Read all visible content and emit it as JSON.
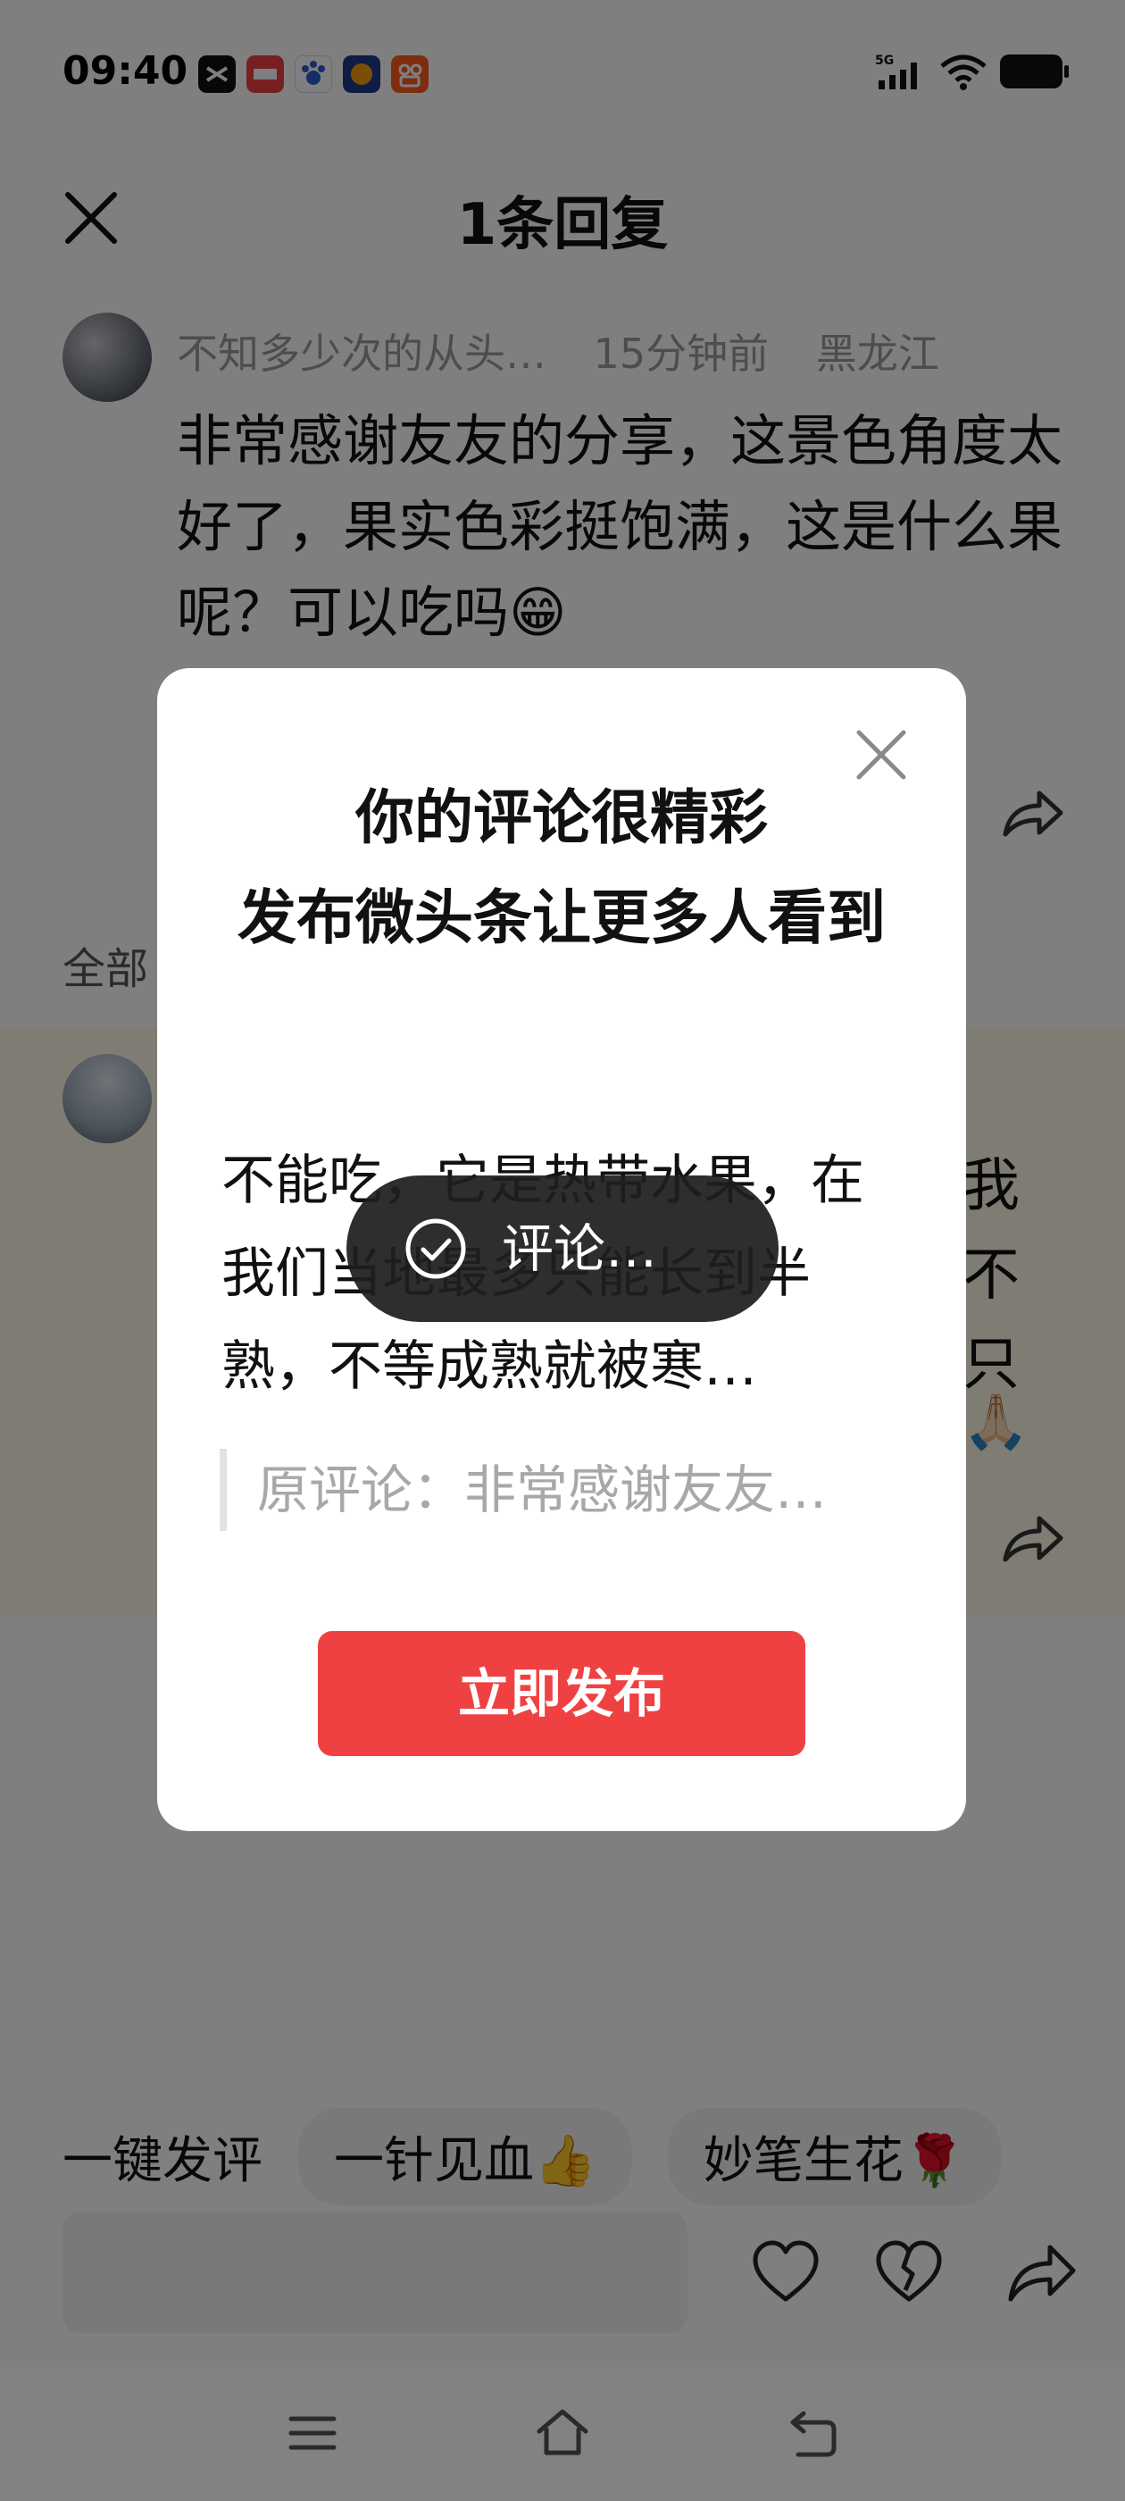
{
  "status_bar": {
    "time": "09:40",
    "network": "5G",
    "app_icons": [
      "capcut-icon",
      "toutiao-news-icon",
      "baidu-icon",
      "game-icon",
      "kuaishou-icon"
    ]
  },
  "sheet": {
    "title": "1条回复",
    "original_comment": {
      "username": "不知多少次的从头…",
      "time_ago": "15分钟前",
      "location": "黑龙江",
      "text": "非常感谢友友的分享，这景色角度太好了，果实色彩挺饱满，这是什么果呢？可以吃吗😁"
    },
    "section_label": "全部",
    "reply_partial_chars": [
      "我",
      "不",
      "只",
      "🙏🏻"
    ]
  },
  "quick_replies": {
    "lead": "一键发评",
    "chips": [
      "一针见血👍",
      "妙笔生花🌹"
    ]
  },
  "dialog": {
    "title_line1": "你的评论很精彩",
    "title_line2": "发布微头条让更多人看到",
    "reply_text": "不能吃，它是热带水果，在我们当地最多只能长到半熟，不等成熟就被寒…",
    "quote": "原评论：非常感谢友友…",
    "publish_button": "立即发布"
  },
  "toast": {
    "text": "评论…"
  },
  "colors": {
    "accent": "#f04142",
    "overlay": "rgba(0,0,0,0.5)",
    "reply_highlight": "#fff8e8"
  }
}
